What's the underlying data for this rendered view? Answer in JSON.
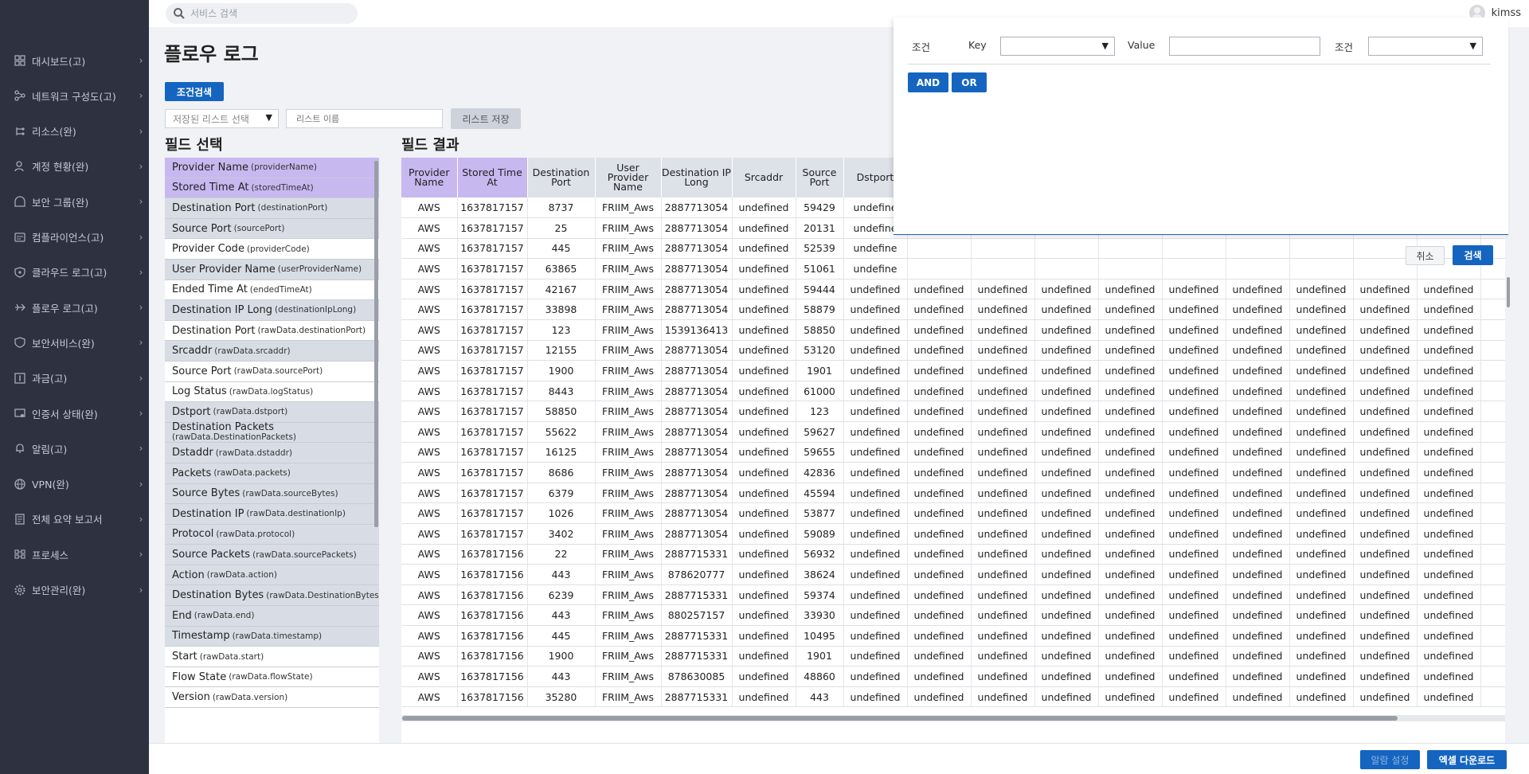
{
  "sidebar": {
    "items": [
      {
        "label": "대시보드(고)",
        "icon": "dashboard-icon"
      },
      {
        "label": "네트워크 구성도(고)",
        "icon": "network-icon"
      },
      {
        "label": "리소스(완)",
        "icon": "resource-icon"
      },
      {
        "label": "계정 현황(완)",
        "icon": "account-icon"
      },
      {
        "label": "보안 그룹(완)",
        "icon": "security-group-icon"
      },
      {
        "label": "컴플라이언스(고)",
        "icon": "compliance-icon"
      },
      {
        "label": "클라우드 로그(고)",
        "icon": "cloud-log-icon"
      },
      {
        "label": "플로우 로그(고)",
        "icon": "flow-log-icon"
      },
      {
        "label": "보안서비스(완)",
        "icon": "security-service-icon"
      },
      {
        "label": "과금(고)",
        "icon": "billing-icon"
      },
      {
        "label": "인증서 상태(완)",
        "icon": "certificate-icon"
      },
      {
        "label": "알림(고)",
        "icon": "bell-icon"
      },
      {
        "label": "VPN(완)",
        "icon": "vpn-icon"
      },
      {
        "label": "전체 요약 보고서",
        "icon": "report-icon"
      },
      {
        "label": "프로세스",
        "icon": "process-icon"
      },
      {
        "label": "보안관리(완)",
        "icon": "gear-icon"
      }
    ]
  },
  "topbar": {
    "search_placeholder": "서비스 검색",
    "username": "kimss"
  },
  "page": {
    "title": "플로우 로그",
    "condition_search_label": "조건검색",
    "saved_list_placeholder": "저장된 리스트 선택",
    "list_name_placeholder": "리스트 이름",
    "list_save_label": "리스트 저장",
    "field_select_title": "필드 선택",
    "field_result_title": "필드 결과"
  },
  "fields": [
    {
      "label": "Provider Name",
      "key": "(providerName)",
      "state": "highlighted"
    },
    {
      "label": "Stored Time At",
      "key": "(storedTimeAt)",
      "state": "highlighted"
    },
    {
      "label": "Destination Port",
      "key": "(destinationPort)",
      "state": "selected"
    },
    {
      "label": "Source Port",
      "key": "(sourcePort)",
      "state": "selected"
    },
    {
      "label": "Provider Code",
      "key": "(providerCode)",
      "state": "normal"
    },
    {
      "label": "User Provider Name",
      "key": "(userProviderName)",
      "state": "selected"
    },
    {
      "label": "Ended Time At",
      "key": "(endedTimeAt)",
      "state": "normal"
    },
    {
      "label": "Destination IP Long",
      "key": "(destinationIpLong)",
      "state": "selected"
    },
    {
      "label": "Destination Port",
      "key": "(rawData.destinationPort)",
      "state": "normal"
    },
    {
      "label": "Srcaddr",
      "key": "(rawData.srcaddr)",
      "state": "selected"
    },
    {
      "label": "Source Port",
      "key": "(rawData.sourcePort)",
      "state": "normal"
    },
    {
      "label": "Log Status",
      "key": "(rawData.logStatus)",
      "state": "normal"
    },
    {
      "label": "Dstport",
      "key": "(rawData.dstport)",
      "state": "selected"
    },
    {
      "label": "Destination Packets",
      "key": "(rawData.DestinationPackets)",
      "state": "selected",
      "two_line": true
    },
    {
      "label": "Dstaddr",
      "key": "(rawData.dstaddr)",
      "state": "selected"
    },
    {
      "label": "Packets",
      "key": "(rawData.packets)",
      "state": "selected"
    },
    {
      "label": "Source Bytes",
      "key": "(rawData.sourceBytes)",
      "state": "selected"
    },
    {
      "label": "Destination IP",
      "key": "(rawData.destinationIp)",
      "state": "selected"
    },
    {
      "label": "Protocol",
      "key": "(rawData.protocol)",
      "state": "selected"
    },
    {
      "label": "Source Packets",
      "key": "(rawData.sourcePackets)",
      "state": "selected"
    },
    {
      "label": "Action",
      "key": "(rawData.action)",
      "state": "selected"
    },
    {
      "label": "Destination Bytes",
      "key": "(rawData.DestinationBytes)",
      "state": "selected"
    },
    {
      "label": "End",
      "key": "(rawData.end)",
      "state": "selected"
    },
    {
      "label": "Timestamp",
      "key": "(rawData.timestamp)",
      "state": "selected"
    },
    {
      "label": "Start",
      "key": "(rawData.start)",
      "state": "normal"
    },
    {
      "label": "Flow State",
      "key": "(rawData.flowState)",
      "state": "normal"
    },
    {
      "label": "Version",
      "key": "(rawData.version)",
      "state": "normal"
    }
  ],
  "table": {
    "columns": [
      {
        "label": "Provider Name",
        "highlight": true
      },
      {
        "label": "Stored Time At",
        "highlight": true
      },
      {
        "label": "Destination Port",
        "highlight": false
      },
      {
        "label": "User Provider Name",
        "highlight": false
      },
      {
        "label": "Destination IP Long",
        "highlight": false
      },
      {
        "label": "Srcaddr",
        "highlight": false
      },
      {
        "label": "Source Port",
        "highlight": false
      },
      {
        "label": "Dstport",
        "highlight": false
      },
      {
        "label": "",
        "highlight": false
      },
      {
        "label": "",
        "highlight": false
      },
      {
        "label": "",
        "highlight": false
      },
      {
        "label": "",
        "highlight": false
      },
      {
        "label": "",
        "highlight": false
      },
      {
        "label": "",
        "highlight": false
      },
      {
        "label": "",
        "highlight": false
      },
      {
        "label": "",
        "highlight": false
      },
      {
        "label": "",
        "highlight": false
      },
      {
        "label": "",
        "highlight": false
      }
    ],
    "rows": [
      [
        "AWS",
        "1637817157",
        "8737",
        "FRIIM_Aws",
        "2887713054",
        "undefined",
        "59429",
        "undefine",
        "",
        "",
        "",
        "",
        "",
        "",
        "",
        "",
        "",
        ""
      ],
      [
        "AWS",
        "1637817157",
        "25",
        "FRIIM_Aws",
        "2887713054",
        "undefined",
        "20131",
        "undefine",
        "",
        "",
        "",
        "",
        "",
        "",
        "",
        "",
        "",
        ""
      ],
      [
        "AWS",
        "1637817157",
        "445",
        "FRIIM_Aws",
        "2887713054",
        "undefined",
        "52539",
        "undefine",
        "",
        "",
        "",
        "",
        "",
        "",
        "",
        "",
        "",
        ""
      ],
      [
        "AWS",
        "1637817157",
        "63865",
        "FRIIM_Aws",
        "2887713054",
        "undefined",
        "51061",
        "undefine",
        "",
        "",
        "",
        "",
        "",
        "",
        "",
        "",
        "",
        ""
      ],
      [
        "AWS",
        "1637817157",
        "42167",
        "FRIIM_Aws",
        "2887713054",
        "undefined",
        "59444",
        "undefined",
        "undefined",
        "undefined",
        "undefined",
        "undefined",
        "undefined",
        "undefined",
        "undefined",
        "undefined",
        "undefined",
        "u"
      ],
      [
        "AWS",
        "1637817157",
        "33898",
        "FRIIM_Aws",
        "2887713054",
        "undefined",
        "58879",
        "undefined",
        "undefined",
        "undefined",
        "undefined",
        "undefined",
        "undefined",
        "undefined",
        "undefined",
        "undefined",
        "undefined",
        "u"
      ],
      [
        "AWS",
        "1637817157",
        "123",
        "FRIIM_Aws",
        "1539136413",
        "undefined",
        "58850",
        "undefined",
        "undefined",
        "undefined",
        "undefined",
        "undefined",
        "undefined",
        "undefined",
        "undefined",
        "undefined",
        "undefined",
        "u"
      ],
      [
        "AWS",
        "1637817157",
        "12155",
        "FRIIM_Aws",
        "2887713054",
        "undefined",
        "53120",
        "undefined",
        "undefined",
        "undefined",
        "undefined",
        "undefined",
        "undefined",
        "undefined",
        "undefined",
        "undefined",
        "undefined",
        "u"
      ],
      [
        "AWS",
        "1637817157",
        "1900",
        "FRIIM_Aws",
        "2887713054",
        "undefined",
        "1901",
        "undefined",
        "undefined",
        "undefined",
        "undefined",
        "undefined",
        "undefined",
        "undefined",
        "undefined",
        "undefined",
        "undefined",
        "u"
      ],
      [
        "AWS",
        "1637817157",
        "8443",
        "FRIIM_Aws",
        "2887713054",
        "undefined",
        "61000",
        "undefined",
        "undefined",
        "undefined",
        "undefined",
        "undefined",
        "undefined",
        "undefined",
        "undefined",
        "undefined",
        "undefined",
        "u"
      ],
      [
        "AWS",
        "1637817157",
        "58850",
        "FRIIM_Aws",
        "2887713054",
        "undefined",
        "123",
        "undefined",
        "undefined",
        "undefined",
        "undefined",
        "undefined",
        "undefined",
        "undefined",
        "undefined",
        "undefined",
        "undefined",
        "u"
      ],
      [
        "AWS",
        "1637817157",
        "55622",
        "FRIIM_Aws",
        "2887713054",
        "undefined",
        "59627",
        "undefined",
        "undefined",
        "undefined",
        "undefined",
        "undefined",
        "undefined",
        "undefined",
        "undefined",
        "undefined",
        "undefined",
        "u"
      ],
      [
        "AWS",
        "1637817157",
        "16125",
        "FRIIM_Aws",
        "2887713054",
        "undefined",
        "59655",
        "undefined",
        "undefined",
        "undefined",
        "undefined",
        "undefined",
        "undefined",
        "undefined",
        "undefined",
        "undefined",
        "undefined",
        "u"
      ],
      [
        "AWS",
        "1637817157",
        "8686",
        "FRIIM_Aws",
        "2887713054",
        "undefined",
        "42836",
        "undefined",
        "undefined",
        "undefined",
        "undefined",
        "undefined",
        "undefined",
        "undefined",
        "undefined",
        "undefined",
        "undefined",
        "u"
      ],
      [
        "AWS",
        "1637817157",
        "6379",
        "FRIIM_Aws",
        "2887713054",
        "undefined",
        "45594",
        "undefined",
        "undefined",
        "undefined",
        "undefined",
        "undefined",
        "undefined",
        "undefined",
        "undefined",
        "undefined",
        "undefined",
        "u"
      ],
      [
        "AWS",
        "1637817157",
        "1026",
        "FRIIM_Aws",
        "2887713054",
        "undefined",
        "53877",
        "undefined",
        "undefined",
        "undefined",
        "undefined",
        "undefined",
        "undefined",
        "undefined",
        "undefined",
        "undefined",
        "undefined",
        "u"
      ],
      [
        "AWS",
        "1637817157",
        "3402",
        "FRIIM_Aws",
        "2887713054",
        "undefined",
        "59089",
        "undefined",
        "undefined",
        "undefined",
        "undefined",
        "undefined",
        "undefined",
        "undefined",
        "undefined",
        "undefined",
        "undefined",
        "u"
      ],
      [
        "AWS",
        "1637817156",
        "22",
        "FRIIM_Aws",
        "2887715331",
        "undefined",
        "56932",
        "undefined",
        "undefined",
        "undefined",
        "undefined",
        "undefined",
        "undefined",
        "undefined",
        "undefined",
        "undefined",
        "undefined",
        "u"
      ],
      [
        "AWS",
        "1637817156",
        "443",
        "FRIIM_Aws",
        "878620777",
        "undefined",
        "38624",
        "undefined",
        "undefined",
        "undefined",
        "undefined",
        "undefined",
        "undefined",
        "undefined",
        "undefined",
        "undefined",
        "undefined",
        "u"
      ],
      [
        "AWS",
        "1637817156",
        "6239",
        "FRIIM_Aws",
        "2887715331",
        "undefined",
        "59374",
        "undefined",
        "undefined",
        "undefined",
        "undefined",
        "undefined",
        "undefined",
        "undefined",
        "undefined",
        "undefined",
        "undefined",
        "u"
      ],
      [
        "AWS",
        "1637817156",
        "443",
        "FRIIM_Aws",
        "880257157",
        "undefined",
        "33930",
        "undefined",
        "undefined",
        "undefined",
        "undefined",
        "undefined",
        "undefined",
        "undefined",
        "undefined",
        "undefined",
        "undefined",
        "u"
      ],
      [
        "AWS",
        "1637817156",
        "445",
        "FRIIM_Aws",
        "2887715331",
        "undefined",
        "10495",
        "undefined",
        "undefined",
        "undefined",
        "undefined",
        "undefined",
        "undefined",
        "undefined",
        "undefined",
        "undefined",
        "undefined",
        "u"
      ],
      [
        "AWS",
        "1637817156",
        "1900",
        "FRIIM_Aws",
        "2887715331",
        "undefined",
        "1901",
        "undefined",
        "undefined",
        "undefined",
        "undefined",
        "undefined",
        "undefined",
        "undefined",
        "undefined",
        "undefined",
        "undefined",
        "u"
      ],
      [
        "AWS",
        "1637817156",
        "443",
        "FRIIM_Aws",
        "878630085",
        "undefined",
        "48860",
        "undefined",
        "undefined",
        "undefined",
        "undefined",
        "undefined",
        "undefined",
        "undefined",
        "undefined",
        "undefined",
        "undefined",
        "u"
      ],
      [
        "AWS",
        "1637817156",
        "35280",
        "FRIIM_Aws",
        "2887715331",
        "undefined",
        "443",
        "undefined",
        "undefined",
        "undefined",
        "undefined",
        "undefined",
        "undefined",
        "undefined",
        "undefined",
        "undefined",
        "undefined",
        "u"
      ]
    ]
  },
  "filter_popup": {
    "condition_label": "조건",
    "key_label": "Key",
    "key_value": "",
    "value_label": "Value",
    "value_input": "",
    "condition2_label": "조건",
    "condition2_value": "",
    "and_label": "AND",
    "or_label": "OR",
    "cancel_label": "취소",
    "search_label": "검색"
  },
  "bottom": {
    "alarm_setting_label": "알람 설정",
    "excel_download_label": "엑셀 다운로드"
  },
  "colors": {
    "sidebar_bg": "#2e3140",
    "primary": "#1565c0",
    "highlight": "#c8b8f0",
    "selected_row": "#d8dde5"
  }
}
